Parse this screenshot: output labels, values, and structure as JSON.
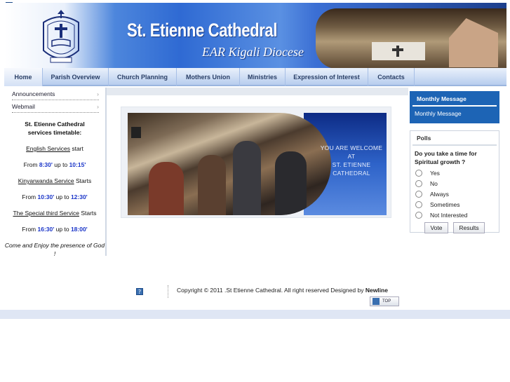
{
  "header": {
    "title": "St. Etienne Cathedral",
    "subtitle": "EAR Kigali Diocese"
  },
  "nav": [
    {
      "label": "Home",
      "active": true
    },
    {
      "label": "Parish Overview"
    },
    {
      "label": "Church Planning"
    },
    {
      "label": "Mothers Union"
    },
    {
      "label": "Ministries"
    },
    {
      "label": "Expression of Interest"
    },
    {
      "label": "Contacts"
    }
  ],
  "sidebar": {
    "links": [
      "Announcements",
      "Webmail"
    ],
    "timetable_title": "St. Etienne Cathedral services timetable:",
    "english_service": "English Services",
    "starts_lower": "start",
    "from": "From",
    "up_to": "up to",
    "english_from": "8:30'",
    "english_to": "10:15'",
    "kinyarwanda_service": "Kinyarwanda Service",
    "starts": "Starts",
    "kiny_from": "10:30'",
    "kiny_to": "12:30'",
    "special_service": "The Special third Service",
    "special_from": "16:30'",
    "special_to": "18:00'",
    "closing": "Come and Enjoy the presence of God !"
  },
  "banner": {
    "line1": "YOU ARE WELCOME",
    "line2": "AT",
    "line3": "ST. ETIENNE",
    "line4": "CATHEDRAL"
  },
  "monthly": {
    "heading": "Monthly Message",
    "link": "Monthly Message"
  },
  "polls": {
    "heading": "Polls",
    "question": "Do you take a time for Spiritual growth ?",
    "options": [
      "Yes",
      "No",
      "Always",
      "Sometimes",
      "Not Interested"
    ],
    "vote": "Vote",
    "results": "Results"
  },
  "footer": {
    "copyright": "Copyright © 2011 .St Etienne Cathedral. All right reserved Designed by",
    "designer": "Newline",
    "top_label": "TOP"
  },
  "colors": {
    "accent": "#1d64b5",
    "time_blue": "#1a35c8"
  },
  "icons": [
    "broken-image-icon",
    "cross-logo-icon",
    "arrow-up-icon"
  ]
}
